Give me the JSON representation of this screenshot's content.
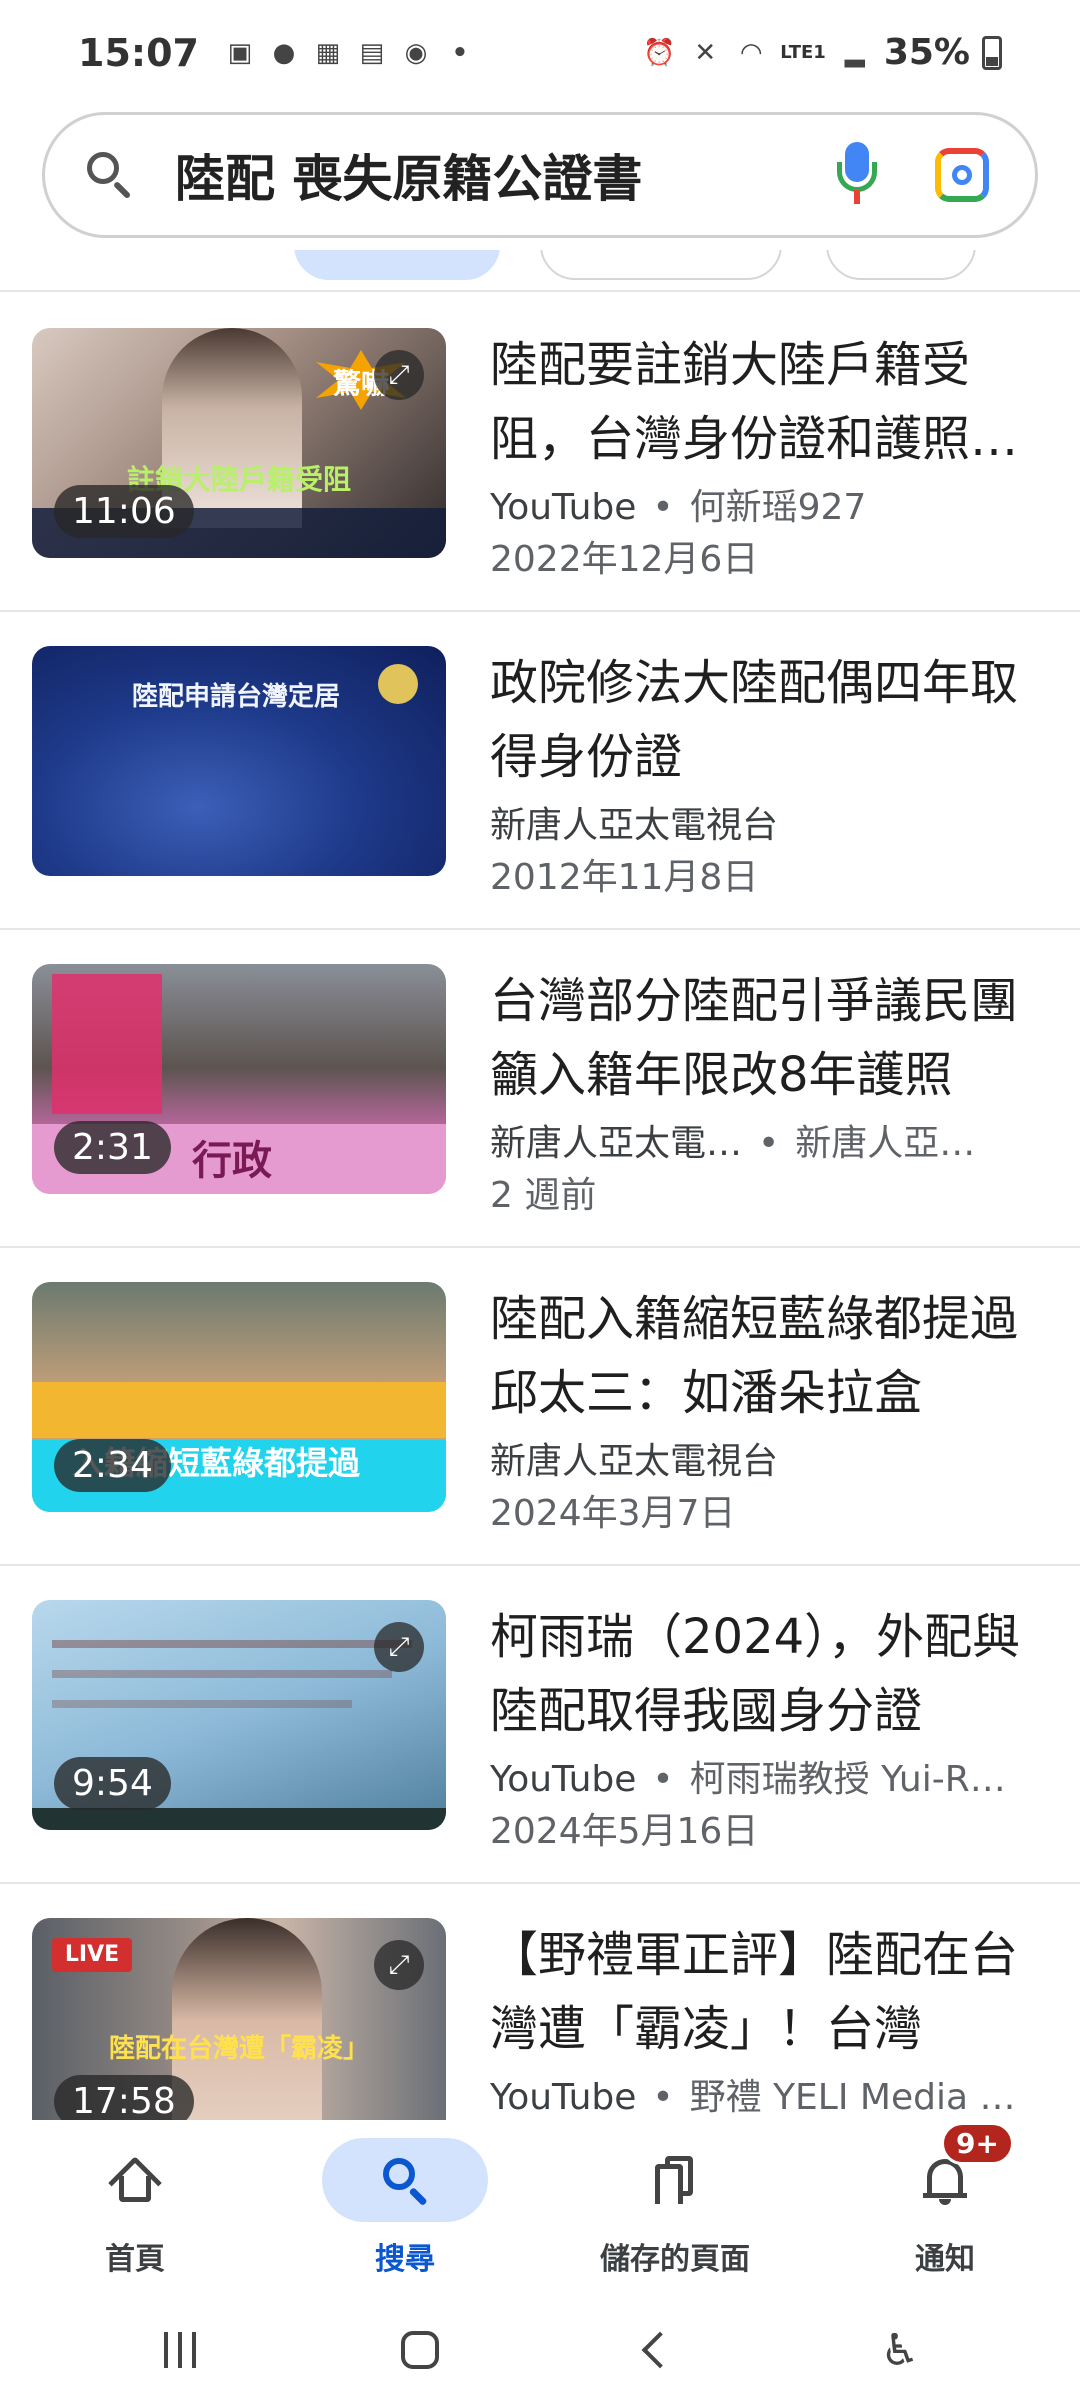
{
  "status_bar": {
    "time": "15:07",
    "battery": "35%",
    "network": "LTE1"
  },
  "search": {
    "query": "陸配 喪失原籍公證書"
  },
  "results": [
    {
      "title": "陸配要註銷大陸戶籍受阻，台灣身份證和護照恐被收回",
      "source": "YouTube",
      "channel": "何新瑶927",
      "date": "2022年12月6日",
      "duration": "11:06",
      "has_expand": true,
      "thumb_caption": "註銷大陸戶籍受阻",
      "thumb_badge": "驚嚇"
    },
    {
      "title": "政院修法大陸配偶四年取得身份證",
      "source": "新唐人亞太電視台",
      "channel": "",
      "date": "2012年11月8日",
      "duration": "",
      "has_expand": false,
      "thumb_caption": "陸配申請台灣定居"
    },
    {
      "title": "台灣部分陸配引爭議民團籲入籍年限改8年護照",
      "source": "新唐人亞太電…",
      "channel": "新唐人亞…",
      "date": "2 週前",
      "duration": "2:31",
      "has_expand": false,
      "thumb_caption": "行政"
    },
    {
      "title": "陸配入籍縮短藍綠都提過邱太三：如潘朵拉盒",
      "source": "新唐人亞太電視台",
      "channel": "",
      "date": "2024年3月7日",
      "duration": "2:34",
      "has_expand": false,
      "thumb_caption": "入籍縮短藍綠都提過"
    },
    {
      "title": "柯雨瑞（2024），外配與陸配取得我國身分證",
      "source": "YouTube",
      "channel": "柯雨瑞教授 Yui-R…",
      "date": "2024年5月16日",
      "duration": "9:54",
      "has_expand": true,
      "thumb_caption": ""
    },
    {
      "title": "【野禮軍正評】陸配在台灣遭「霸凌」！台灣",
      "source": "YouTube",
      "channel": "野禮 YELI Media …",
      "date": "",
      "duration": "17:58",
      "has_expand": true,
      "thumb_caption": "陸配在台灣遭「霸凌」"
    }
  ],
  "bottom_nav": [
    {
      "label": "首頁",
      "icon": "home-icon",
      "active": false
    },
    {
      "label": "搜尋",
      "icon": "search-icon",
      "active": true
    },
    {
      "label": "儲存的頁面",
      "icon": "bookmark-icon",
      "active": false
    },
    {
      "label": "通知",
      "icon": "bell-icon",
      "active": false,
      "badge": "9+"
    }
  ],
  "colors": {
    "accent": "#0b57d0",
    "active_pill": "#d3e3fd",
    "badge": "#b3261e"
  }
}
